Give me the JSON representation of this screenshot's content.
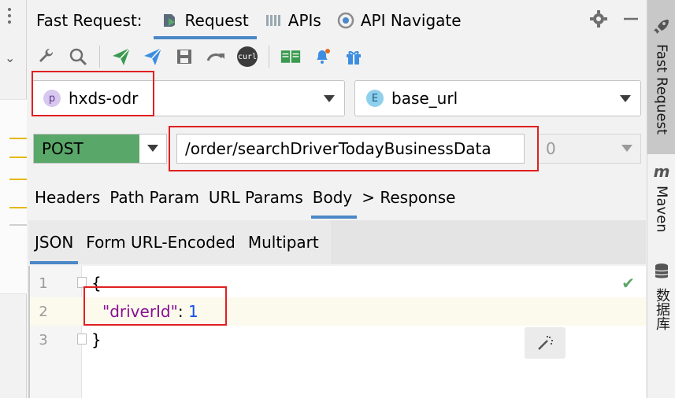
{
  "header": {
    "title": "Fast Request:",
    "tabs": [
      {
        "label": "Request",
        "icon": "request-icon",
        "active": true
      },
      {
        "label": "APIs",
        "icon": "apis-icon",
        "active": false
      },
      {
        "label": "API Navigate",
        "icon": "navigate-icon",
        "active": false
      }
    ]
  },
  "toolbar": {
    "icons": [
      "wrench-icon",
      "search-icon",
      "send-icon",
      "send-debug-icon",
      "save-icon",
      "redo-icon",
      "curl-icon",
      "docs-icon",
      "notify-icon",
      "gift-icon"
    ],
    "curl_label": "curl"
  },
  "project_select": {
    "badge": "p",
    "value": "hxds-odr"
  },
  "env_select": {
    "badge": "E",
    "value": "base_url"
  },
  "method": {
    "value": "POST"
  },
  "url": {
    "value": "/order/searchDriverTodayBusinessData"
  },
  "port": {
    "value": "0"
  },
  "param_tabs": [
    "Headers",
    "Path Param",
    "URL Params",
    "Body",
    "> Response"
  ],
  "body_tabs": [
    "JSON",
    "Form URL-Encoded",
    "Multipart"
  ],
  "editor": {
    "lines": [
      {
        "no": "1",
        "text": "{"
      },
      {
        "no": "2",
        "key": "\"driverId\"",
        "sep": ": ",
        "value": "1"
      },
      {
        "no": "3",
        "text": "}"
      }
    ]
  },
  "right_sidebar": {
    "items": [
      {
        "label": "Fast Request",
        "icon": "rocket-icon"
      },
      {
        "label": "Maven",
        "icon": "maven-icon"
      },
      {
        "label": "数据库",
        "icon": "database-icon"
      }
    ]
  },
  "colors": {
    "accent": "#4a88c7",
    "method_bg": "#59a869",
    "highlight_box": "#e02020",
    "json_key": "#871094",
    "json_number": "#1750eb"
  }
}
